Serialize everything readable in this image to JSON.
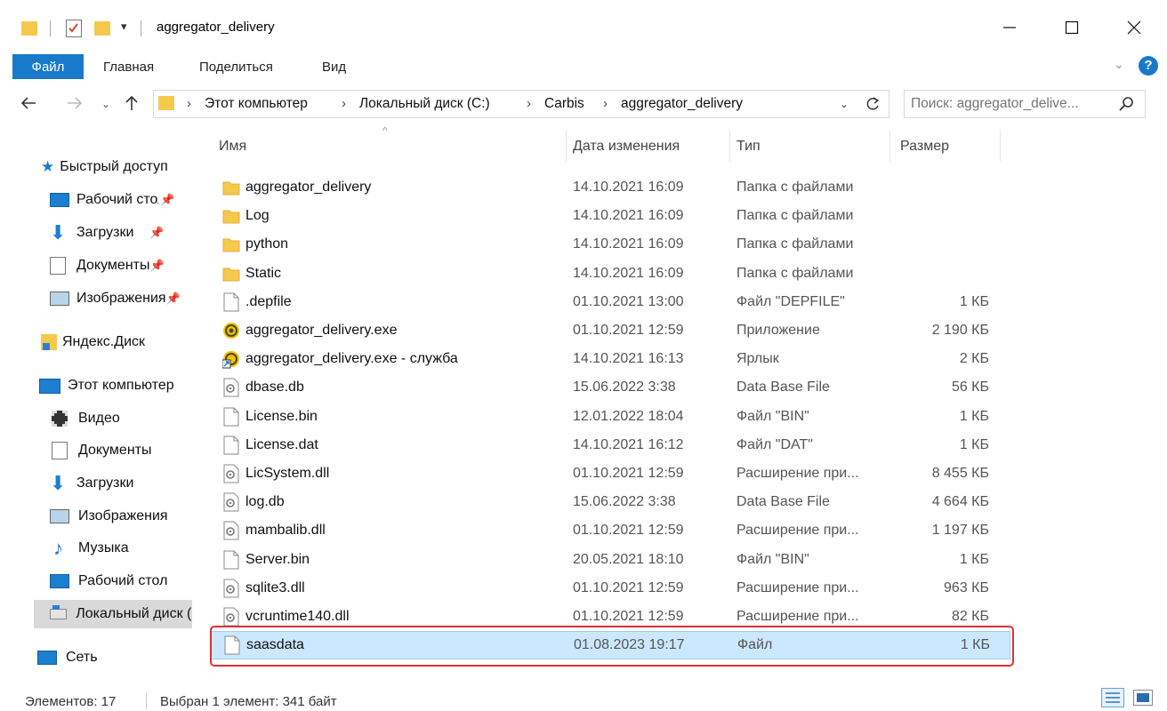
{
  "window": {
    "title": "aggregator_delivery"
  },
  "ribbon": {
    "tabs": [
      "Файл",
      "Главная",
      "Поделиться",
      "Вид"
    ]
  },
  "address": {
    "crumbs": [
      "Этот компьютер",
      "Локальный диск (C:)",
      "Carbis",
      "aggregator_delivery"
    ]
  },
  "search": {
    "placeholder": "Поиск: aggregator_delive..."
  },
  "nav": {
    "quick_access": "Быстрый доступ",
    "items": [
      {
        "label": "Рабочий стол",
        "icon": "desktop-icon",
        "pinned": true
      },
      {
        "label": "Загрузки",
        "icon": "downloads-icon",
        "pinned": true
      },
      {
        "label": "Документы",
        "icon": "documents-icon",
        "pinned": true
      },
      {
        "label": "Изображения",
        "icon": "pictures-icon",
        "pinned": true
      }
    ],
    "yandex": "Яндекс.Диск",
    "this_pc": "Этот компьютер",
    "pc_items": [
      {
        "label": "Видео",
        "icon": "video-icon"
      },
      {
        "label": "Документы",
        "icon": "documents-icon"
      },
      {
        "label": "Загрузки",
        "icon": "downloads-icon"
      },
      {
        "label": "Изображения",
        "icon": "pictures-icon"
      },
      {
        "label": "Музыка",
        "icon": "music-icon"
      },
      {
        "label": "Рабочий стол",
        "icon": "desktop-icon"
      },
      {
        "label": "Локальный диск (C:)",
        "icon": "drive-icon"
      }
    ],
    "network": "Сеть"
  },
  "columns": {
    "name": "Имя",
    "date": "Дата изменения",
    "type": "Тип",
    "size": "Размер"
  },
  "files": [
    {
      "name": "aggregator_delivery",
      "date": "14.10.2021 16:09",
      "type": "Папка с файлами",
      "size": "",
      "icon": "folder-icon"
    },
    {
      "name": "Log",
      "date": "14.10.2021 16:09",
      "type": "Папка с файлами",
      "size": "",
      "icon": "folder-icon"
    },
    {
      "name": "python",
      "date": "14.10.2021 16:09",
      "type": "Папка с файлами",
      "size": "",
      "icon": "folder-icon"
    },
    {
      "name": "Static",
      "date": "14.10.2021 16:09",
      "type": "Папка с файлами",
      "size": "",
      "icon": "folder-icon"
    },
    {
      "name": ".depfile",
      "date": "01.10.2021 13:00",
      "type": "Файл \"DEPFILE\"",
      "size": "1 КБ",
      "icon": "file-icon"
    },
    {
      "name": "aggregator_delivery.exe",
      "date": "01.10.2021 12:59",
      "type": "Приложение",
      "size": "2 190 КБ",
      "icon": "app-icon"
    },
    {
      "name": "aggregator_delivery.exe - служба",
      "date": "14.10.2021 16:13",
      "type": "Ярлык",
      "size": "2 КБ",
      "icon": "shortcut-icon"
    },
    {
      "name": "dbase.db",
      "date": "15.06.2022 3:38",
      "type": "Data Base File",
      "size": "56 КБ",
      "icon": "gear-file-icon"
    },
    {
      "name": "License.bin",
      "date": "12.01.2022 18:04",
      "type": "Файл \"BIN\"",
      "size": "1 КБ",
      "icon": "file-icon"
    },
    {
      "name": "License.dat",
      "date": "14.10.2021 16:12",
      "type": "Файл \"DAT\"",
      "size": "1 КБ",
      "icon": "file-icon"
    },
    {
      "name": "LicSystem.dll",
      "date": "01.10.2021 12:59",
      "type": "Расширение при...",
      "size": "8 455 КБ",
      "icon": "gear-file-icon"
    },
    {
      "name": "log.db",
      "date": "15.06.2022 3:38",
      "type": "Data Base File",
      "size": "4 664 КБ",
      "icon": "gear-file-icon"
    },
    {
      "name": "mambalib.dll",
      "date": "01.10.2021 12:59",
      "type": "Расширение при...",
      "size": "1 197 КБ",
      "icon": "gear-file-icon"
    },
    {
      "name": "Server.bin",
      "date": "20.05.2021 18:10",
      "type": "Файл \"BIN\"",
      "size": "1 КБ",
      "icon": "file-icon"
    },
    {
      "name": "sqlite3.dll",
      "date": "01.10.2021 12:59",
      "type": "Расширение при...",
      "size": "963 КБ",
      "icon": "gear-file-icon"
    },
    {
      "name": "vcruntime140.dll",
      "date": "01.10.2021 12:59",
      "type": "Расширение при...",
      "size": "82 КБ",
      "icon": "gear-file-icon"
    },
    {
      "name": "saasdata",
      "date": "01.08.2023 19:17",
      "type": "Файл",
      "size": "1 КБ",
      "icon": "file-icon",
      "selected": true
    }
  ],
  "status": {
    "count": "Элементов: 17",
    "selection": "Выбран 1 элемент: 341 байт"
  },
  "colors": {
    "accent": "#1979ca",
    "selection": "#cce8ff",
    "highlight": "#e03131",
    "folder": "#f6c84c"
  }
}
